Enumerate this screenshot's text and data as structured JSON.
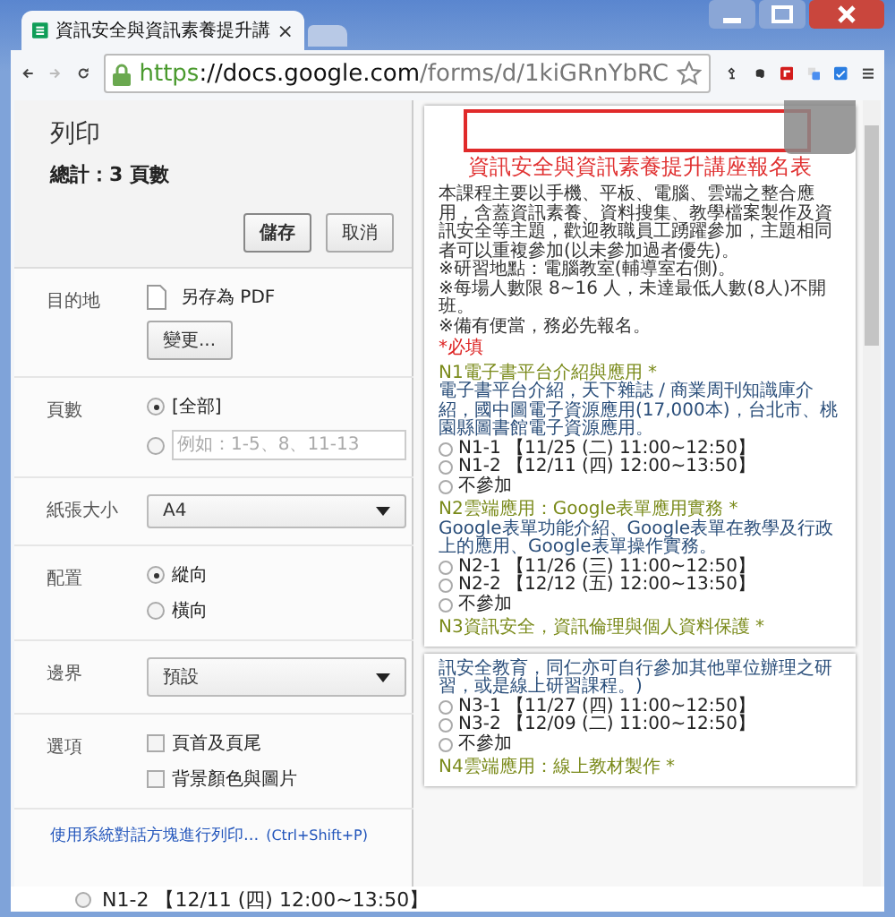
{
  "browser_tab": {
    "title": "資訊安全與資訊素養提升講",
    "close": "×"
  },
  "address_bar": {
    "scheme": "https",
    "rest_host": "://docs.google.com",
    "path": "/forms/d/1kiGRnYbRC"
  },
  "print_panel": {
    "title": "列印",
    "total": "總計：3 頁數",
    "buttons": [
      {
        "label": "儲存",
        "kind": "primary"
      },
      {
        "label": "取消",
        "kind": "plain"
      }
    ],
    "settings": [
      {
        "kind": "destination",
        "label": "目的地",
        "value": "另存為 PDF",
        "button": "變更..."
      },
      {
        "kind": "radios",
        "label": "頁數",
        "options": [
          {
            "label": "[全部]",
            "selected": true
          },
          {
            "placeholder": "例如：1-5、8、11-13",
            "selected": false
          }
        ]
      },
      {
        "kind": "select",
        "label": "紙張大小",
        "value": "A4"
      },
      {
        "kind": "radios",
        "label": "配置",
        "options": [
          {
            "label": "縱向",
            "selected": true
          },
          {
            "label": "橫向",
            "selected": false
          }
        ]
      },
      {
        "kind": "select",
        "label": "邊界",
        "value": "預設"
      },
      {
        "kind": "checkboxes",
        "label": "選項",
        "options": [
          {
            "label": "頁首及頁尾",
            "checked": false
          },
          {
            "label": "背景顏色與圖片",
            "checked": false
          }
        ]
      }
    ],
    "system_dialog_link": "使用系統對話方塊進行列印...",
    "shortcut": "(Ctrl+Shift+P)"
  },
  "preview_pages": [
    {
      "items": [
        {
          "kind": "title",
          "text": "資訊安全與資訊素養提升講座報名表"
        },
        {
          "kind": "text",
          "text": "本課程主要以手機、平板、電腦、雲端之整合應用，含蓋資訊素養、資料搜集、教學檔案製作及資訊安全等主題，歡迎教職員工踴躍參加，主題相同者可以重複參加(以未參加過者優先)。"
        },
        {
          "kind": "text",
          "text": "※研習地點：電腦教室(輔導室右側)。"
        },
        {
          "kind": "text",
          "text": "※每場人數限 8~16 人，未達最低人數(8人)不開班。"
        },
        {
          "kind": "text",
          "text": "※備有便當，務必先報名。"
        },
        {
          "kind": "required",
          "text": "*必填"
        },
        {
          "kind": "question",
          "text": "N1電子書平台介紹與應用 *"
        },
        {
          "kind": "desc",
          "text": "電子書平台介紹，天下雜誌 / 商業周刊知識庫介紹，國中圖電子資源應用(17,000本)，台北市、桃園縣圖書館電子資源應用。"
        },
        {
          "kind": "option",
          "text": "N1-1 【11/25 (二) 11:00~12:50】"
        },
        {
          "kind": "option",
          "text": "N1-2 【12/11 (四) 12:00~13:50】"
        },
        {
          "kind": "option",
          "text": "不參加"
        },
        {
          "kind": "question",
          "text": "N2雲端應用：Google表單應用實務 *"
        },
        {
          "kind": "desc",
          "text": "Google表單功能介紹、Google表單在教學及行政上的應用、Google表單操作實務。"
        },
        {
          "kind": "option",
          "text": "N2-1 【11/26 (三) 11:00~12:50】"
        },
        {
          "kind": "option",
          "text": "N2-2 【12/12 (五) 12:00~13:50】"
        },
        {
          "kind": "option",
          "text": "不參加"
        },
        {
          "kind": "question",
          "text": "N3資訊安全，資訊倫理與個人資料保護 *"
        }
      ]
    },
    {
      "items": [
        {
          "kind": "desc",
          "text": "訊安全教育，同仁亦可自行參加其他單位辦理之研習，或是線上研習課程。)"
        },
        {
          "kind": "option",
          "text": "N3-1 【11/27 (四) 11:00~12:50】"
        },
        {
          "kind": "option",
          "text": "N3-2 【12/09 (二) 11:00~12:50】"
        },
        {
          "kind": "option",
          "text": "不參加"
        },
        {
          "kind": "question",
          "text": "N4雲端應用：線上教材製作 *"
        }
      ]
    }
  ],
  "page_behind": {
    "option": "N1-2 【12/11 (四) 12:00~13:50】",
    "selected": false
  }
}
